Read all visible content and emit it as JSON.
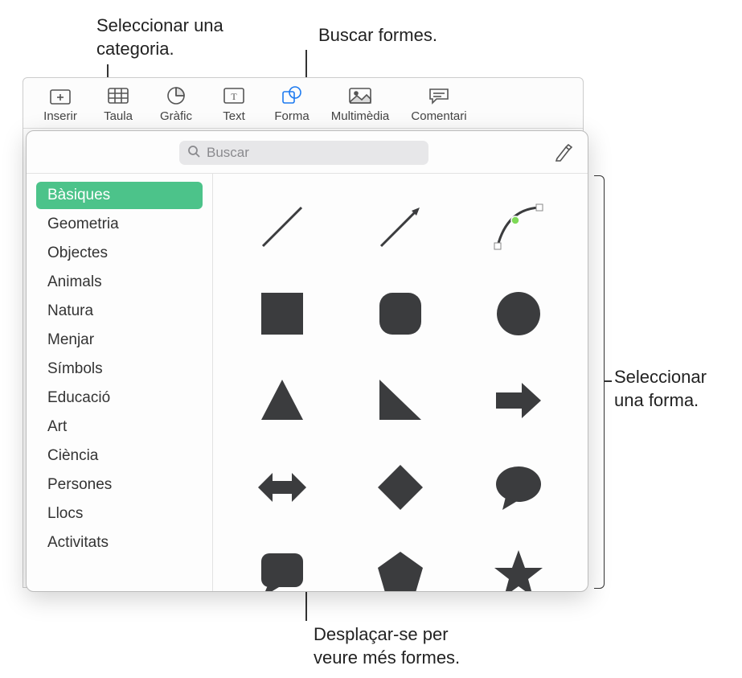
{
  "callouts": {
    "category": "Seleccionar una\ncategoria.",
    "search": "Buscar formes.",
    "select_shape": "Seleccionar\nuna forma.",
    "scroll": "Desplaçar-se per\nveure més formes."
  },
  "toolbar": {
    "items": [
      {
        "label": "Inserir",
        "icon": "insert"
      },
      {
        "label": "Taula",
        "icon": "table"
      },
      {
        "label": "Gràfic",
        "icon": "chart"
      },
      {
        "label": "Text",
        "icon": "text"
      },
      {
        "label": "Forma",
        "icon": "shape",
        "active": true
      },
      {
        "label": "Multimèdia",
        "icon": "media"
      },
      {
        "label": "Comentari",
        "icon": "comment"
      }
    ]
  },
  "search": {
    "placeholder": "Buscar"
  },
  "sidebar": {
    "categories": [
      "Bàsiques",
      "Geometria",
      "Objectes",
      "Animals",
      "Natura",
      "Menjar",
      "Símbols",
      "Educació",
      "Art",
      "Ciència",
      "Persones",
      "Llocs",
      "Activitats"
    ],
    "selected_index": 0
  },
  "shapes": [
    "line",
    "arrow-line",
    "curve",
    "square",
    "rounded-square",
    "circle",
    "triangle",
    "right-triangle",
    "arrow-right",
    "arrow-bidir",
    "diamond",
    "speech-bubble",
    "callout-box",
    "pentagon",
    "star"
  ]
}
